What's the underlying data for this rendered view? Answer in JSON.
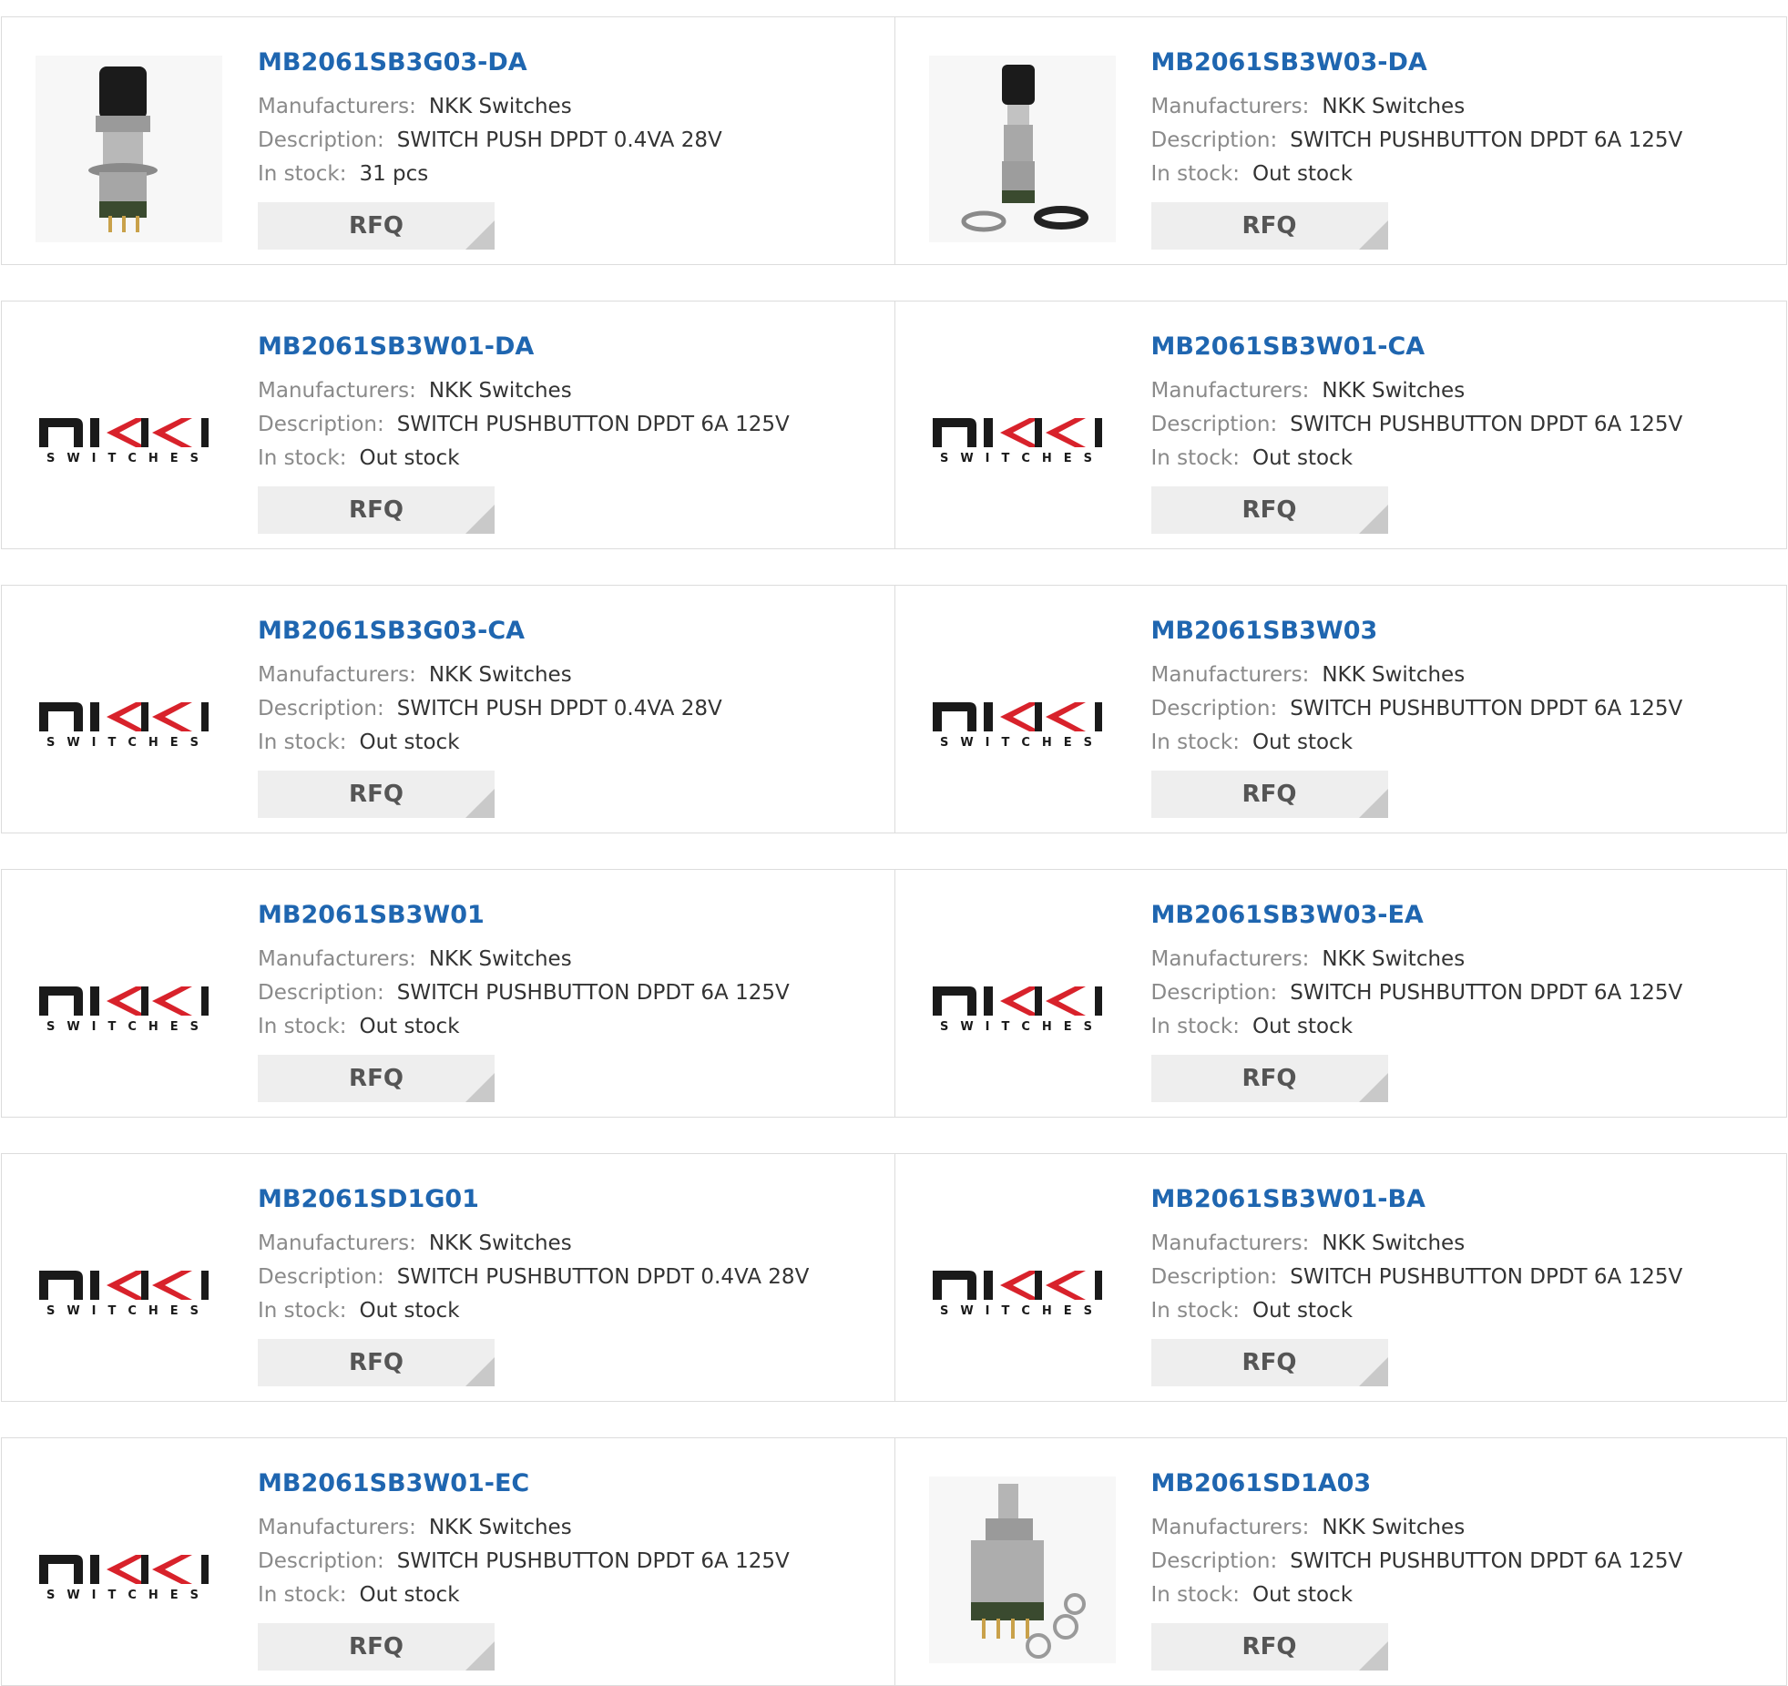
{
  "labels": {
    "manufacturer": "Manufacturers:",
    "description": "Description:",
    "stock": "In stock:",
    "rfq": "RFQ"
  },
  "logo": {
    "wordmark": "NKK",
    "subtitle": "SWITCHES"
  },
  "colors": {
    "title": "#1f66b0",
    "border": "#dcdcdc",
    "button_bg": "#eeeeee"
  },
  "products": [
    {
      "part": "MB2061SB3G03-DA",
      "manufacturer": "NKK Switches",
      "description": "SWITCH PUSH DPDT 0.4VA 28V",
      "stock": "31 pcs",
      "image": "pushbutton-photo"
    },
    {
      "part": "MB2061SB3W03-DA",
      "manufacturer": "NKK Switches",
      "description": "SWITCH PUSHBUTTON DPDT 6A 125V",
      "stock": "Out stock",
      "image": "pushbutton-hardware-photo"
    },
    {
      "part": "MB2061SB3W01-DA",
      "manufacturer": "NKK Switches",
      "description": "SWITCH PUSHBUTTON DPDT 6A 125V",
      "stock": "Out stock",
      "image": "nkk-logo"
    },
    {
      "part": "MB2061SB3W01-CA",
      "manufacturer": "NKK Switches",
      "description": "SWITCH PUSHBUTTON DPDT 6A 125V",
      "stock": "Out stock",
      "image": "nkk-logo"
    },
    {
      "part": "MB2061SB3G03-CA",
      "manufacturer": "NKK Switches",
      "description": "SWITCH PUSH DPDT 0.4VA 28V",
      "stock": "Out stock",
      "image": "nkk-logo"
    },
    {
      "part": "MB2061SB3W03",
      "manufacturer": "NKK Switches",
      "description": "SWITCH PUSHBUTTON DPDT 6A 125V",
      "stock": "Out stock",
      "image": "nkk-logo"
    },
    {
      "part": "MB2061SB3W01",
      "manufacturer": "NKK Switches",
      "description": "SWITCH PUSHBUTTON DPDT 6A 125V",
      "stock": "Out stock",
      "image": "nkk-logo"
    },
    {
      "part": "MB2061SB3W03-EA",
      "manufacturer": "NKK Switches",
      "description": "SWITCH PUSHBUTTON DPDT 6A 125V",
      "stock": "Out stock",
      "image": "nkk-logo"
    },
    {
      "part": "MB2061SD1G01",
      "manufacturer": "NKK Switches",
      "description": "SWITCH PUSHBUTTON DPDT 0.4VA 28V",
      "stock": "Out stock",
      "image": "nkk-logo"
    },
    {
      "part": "MB2061SB3W01-BA",
      "manufacturer": "NKK Switches",
      "description": "SWITCH PUSHBUTTON DPDT 6A 125V",
      "stock": "Out stock",
      "image": "nkk-logo"
    },
    {
      "part": "MB2061SB3W01-EC",
      "manufacturer": "NKK Switches",
      "description": "SWITCH PUSHBUTTON DPDT 6A 125V",
      "stock": "Out stock",
      "image": "nkk-logo"
    },
    {
      "part": "MB2061SD1A03",
      "manufacturer": "NKK Switches",
      "description": "SWITCH PUSHBUTTON DPDT 6A 125V",
      "stock": "Out stock",
      "image": "switch-body-photo"
    }
  ]
}
